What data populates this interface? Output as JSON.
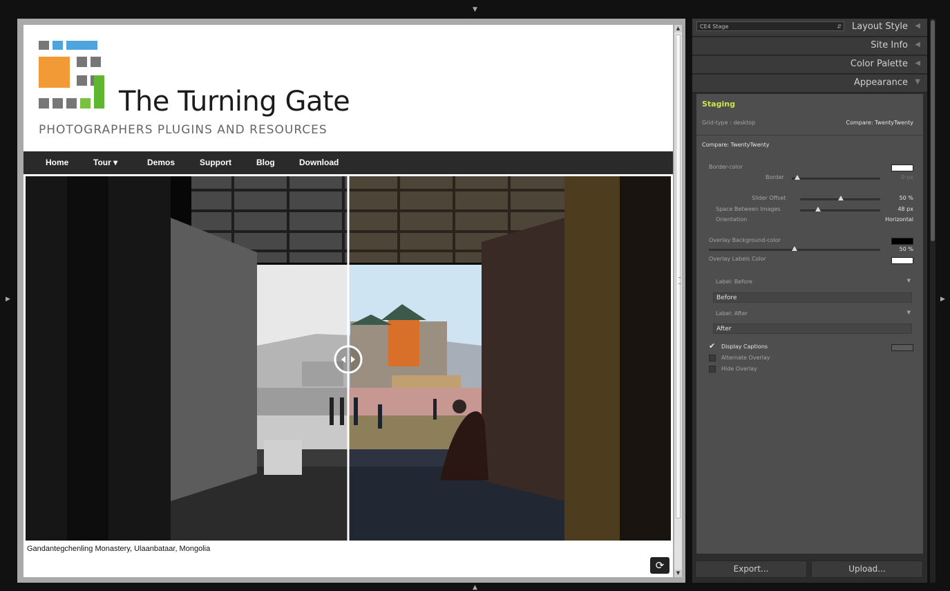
{
  "site": {
    "brand_name": "The Turning Gate",
    "tagline": "PHOTOGRAPHERS PLUGINS AND RESOURCES",
    "nav": [
      {
        "label": "Home"
      },
      {
        "label": "Tour ▾"
      },
      {
        "label": "Demos"
      },
      {
        "label": "Support"
      },
      {
        "label": "Blog"
      },
      {
        "label": "Download"
      }
    ],
    "caption": "Gandantegchenling Monastery, Ulaanbataar, Mongolia",
    "compare_slider_offset": 0.5,
    "refresh_icon": "refresh-icon"
  },
  "panel": {
    "preset_select": "CE4 Stage",
    "sections": {
      "layout_style": "Layout Style",
      "site_info": "Site Info",
      "color_palette": "Color Palette",
      "appearance": "Appearance"
    },
    "staging": {
      "title": "Staging",
      "grid_type_label": "Grid-type : desktop",
      "grid_type_value": "Compare: TwentyTwenty"
    },
    "compare": {
      "heading": "Compare: TwentyTwenty",
      "border_color_label": "Border-color",
      "border_color": "#ffffff",
      "border_label": "Border",
      "border_value": "0 px",
      "border_level": 0,
      "slider_offset_label": "Slider Offset",
      "slider_offset_value": "50 %",
      "slider_offset_level": 0.5,
      "space_label": "Space Between Images",
      "space_value": "48 px",
      "space_level": 0.2,
      "orientation_label": "Orientation",
      "orientation_value": "Horizontal",
      "overlay_bg_label": "Overlay Background-color",
      "overlay_bg_color": "#000000",
      "overlay_opacity_value": "50 %",
      "overlay_opacity_level": 0.5,
      "overlay_labels_label": "Overlay Labels Color",
      "overlay_labels_color": "#ffffff",
      "label_before_label": "Label: Before",
      "label_before_value": "Before",
      "label_after_label": "Label: After",
      "label_after_value": "After",
      "display_captions": "Display Captions",
      "alternate_overlay": "Alternate Overlay",
      "hide_overlay": "Hide Overlay"
    },
    "export_label": "Export...",
    "upload_label": "Upload..."
  }
}
